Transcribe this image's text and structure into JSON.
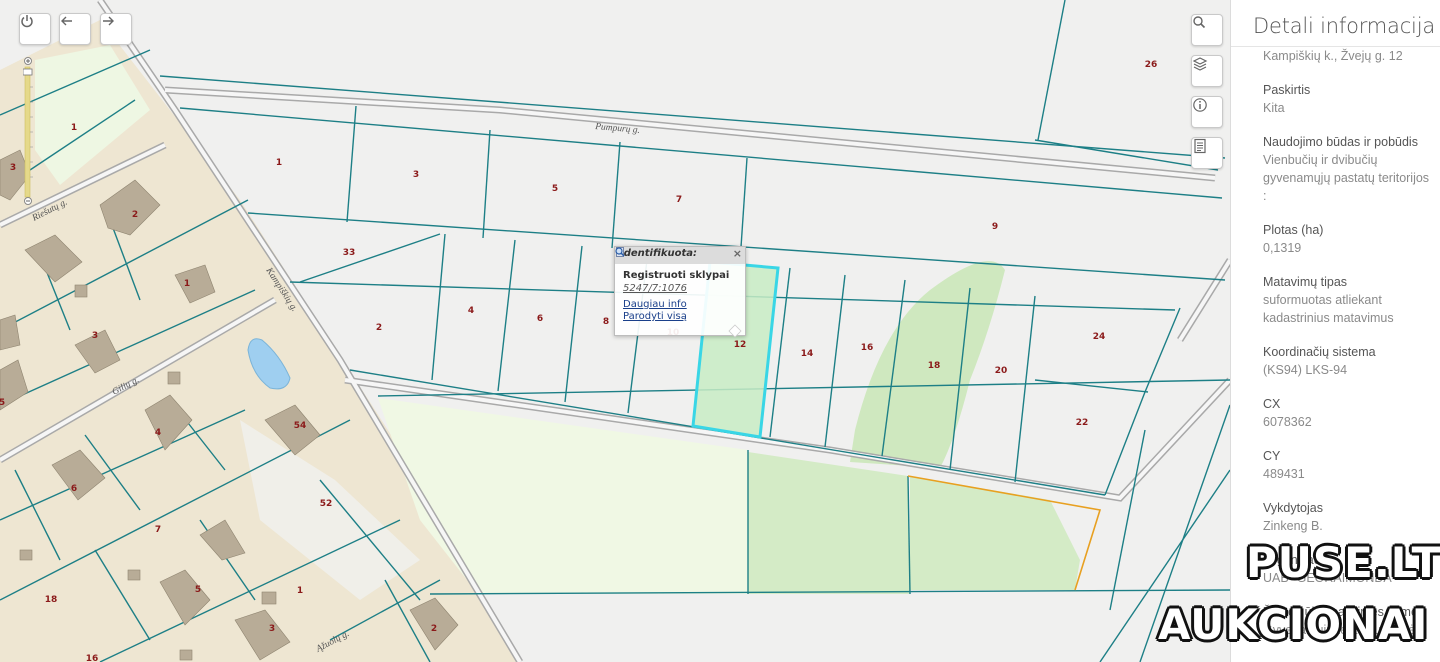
{
  "map": {
    "controls": {
      "power_icon": "power-icon",
      "back_icon": "arrow-left-icon",
      "forward_icon": "arrow-right-icon",
      "search_icon": "search-icon",
      "layers_icon": "layers-icon",
      "info_icon": "info-icon",
      "legend_icon": "document-list-icon"
    },
    "streets": [
      "Pumpurų g.",
      "Riešutų g.",
      "Kampiškių g.",
      "Gilių g.",
      "Ąžuolų g."
    ],
    "parcel_labels": [
      "26",
      "1",
      "3",
      "5",
      "7",
      "9",
      "33",
      "2",
      "4",
      "6",
      "8",
      "10",
      "12",
      "14",
      "16",
      "18",
      "20",
      "24",
      "22",
      "1",
      "2",
      "3",
      "1",
      "3",
      "5",
      "54",
      "4",
      "6",
      "52",
      "7",
      "5",
      "18",
      "1",
      "3",
      "2",
      "16"
    ]
  },
  "popup": {
    "header": "Identifikuota:",
    "close": "×",
    "layer": "Registruoti sklypai",
    "parcel_id": "5247/7:1076",
    "link_more": "Daugiau info",
    "link_show_all": "Parodyti visą"
  },
  "panel": {
    "title": "Detali informacija",
    "address": "Kampiškių k., Žvejų g. 12",
    "fields": [
      {
        "label": "Paskirtis",
        "value": "Kita"
      },
      {
        "label": "Naudojimo būdas ir pobūdis",
        "value": "Vienbučių ir dvibučių gyvenamųjų pastatų teritorijos :"
      },
      {
        "label": "Plotas (ha)",
        "value": "0,1319"
      },
      {
        "label": "Matavimų tipas",
        "value": "suformuotas atliekant kadastrinius matavimus"
      },
      {
        "label": "Koordinačių sistema",
        "value": "(KS94) LKS-94"
      },
      {
        "label": "CX",
        "value": "6078362"
      },
      {
        "label": "CY",
        "value": "489431"
      },
      {
        "label": "Vykdytojas",
        "value": "Zinkeng B."
      },
      {
        "label": "Organizacija",
        "value": "UAB \"GEORAIMONDA\""
      },
      {
        "label": "Žemės ūkio paskirties žemė",
        "value": "Gyvenamųjų teritorijų žemė"
      }
    ]
  },
  "watermark": {
    "line1": "PUSE.LT",
    "line2": "AUKCIONAI"
  }
}
